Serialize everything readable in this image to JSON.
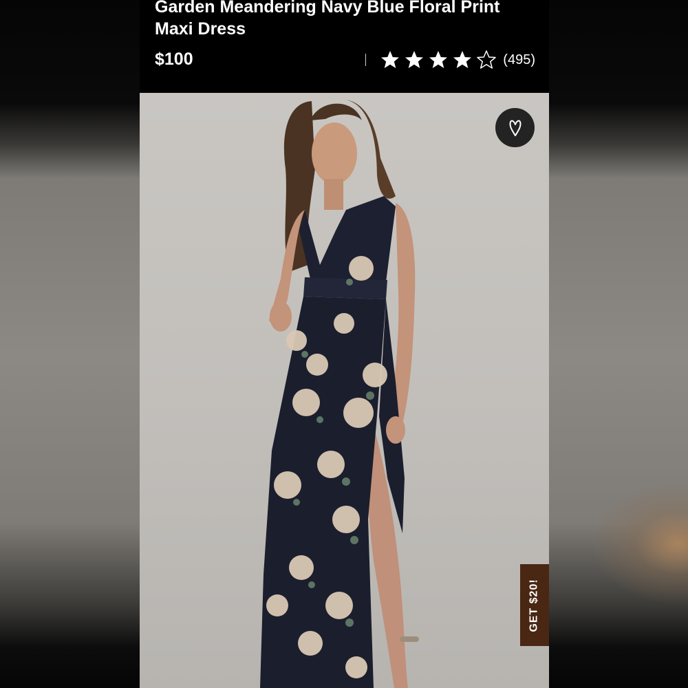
{
  "product": {
    "title": "Garden Meandering Navy Blue Floral Print Maxi Dress",
    "price": "$100",
    "rating": 4,
    "rating_max": 5,
    "review_count": "(495)"
  },
  "icons": {
    "favorite": "heart-icon",
    "star_filled": "star-filled-icon",
    "star_empty": "star-outline-icon"
  },
  "promo": {
    "label": "GET $20!"
  },
  "colors": {
    "header_bg": "#000000",
    "promo_bg": "#4a2712",
    "favorite_bg": "#232323"
  }
}
